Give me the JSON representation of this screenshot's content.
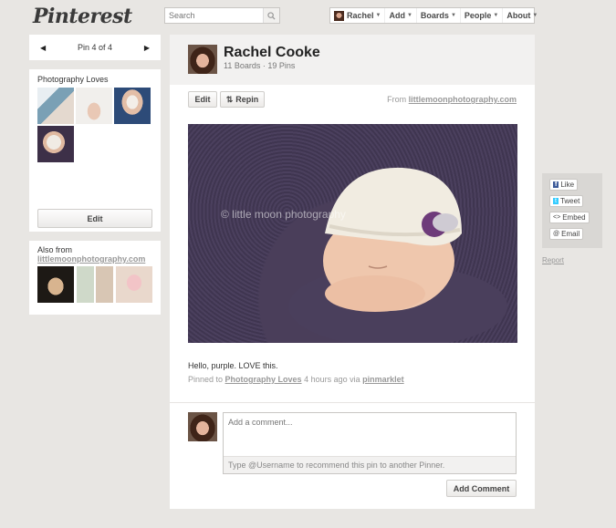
{
  "header": {
    "logo": "Pinterest",
    "search_placeholder": "Search",
    "nav": {
      "user": "Rachel",
      "add": "Add",
      "boards": "Boards",
      "people": "People",
      "about": "About"
    }
  },
  "pager": {
    "label": "Pin 4 of 4"
  },
  "board": {
    "title": "Photography Loves",
    "edit_label": "Edit"
  },
  "also_from": {
    "title": "Also from",
    "link": "littlemoonphotography.com"
  },
  "profile": {
    "name": "Rachel Cooke",
    "stats": "11 Boards · 19 Pins"
  },
  "actions": {
    "edit": "Edit",
    "repin": "Repin"
  },
  "source": {
    "prefix": "From",
    "link": "littlemoonphotography.com"
  },
  "pin": {
    "watermark": "© little moon photography",
    "caption": "Hello, purple. LOVE this.",
    "pinned_prefix": "Pinned to",
    "board_link": "Photography Loves",
    "time": "4 hours ago via",
    "via_link": "pinmarklet"
  },
  "comment": {
    "placeholder": "Add a comment...",
    "hint": "Type @Username to recommend this pin to another Pinner.",
    "submit": "Add Comment"
  },
  "social": {
    "like": "Like",
    "tweet": "Tweet",
    "embed": "Embed",
    "email": "Email",
    "report": "Report"
  },
  "colors": {
    "background": "#e8e6e3",
    "panel": "#ffffff",
    "link": "#999999",
    "accent_fb": "#3b5998"
  }
}
